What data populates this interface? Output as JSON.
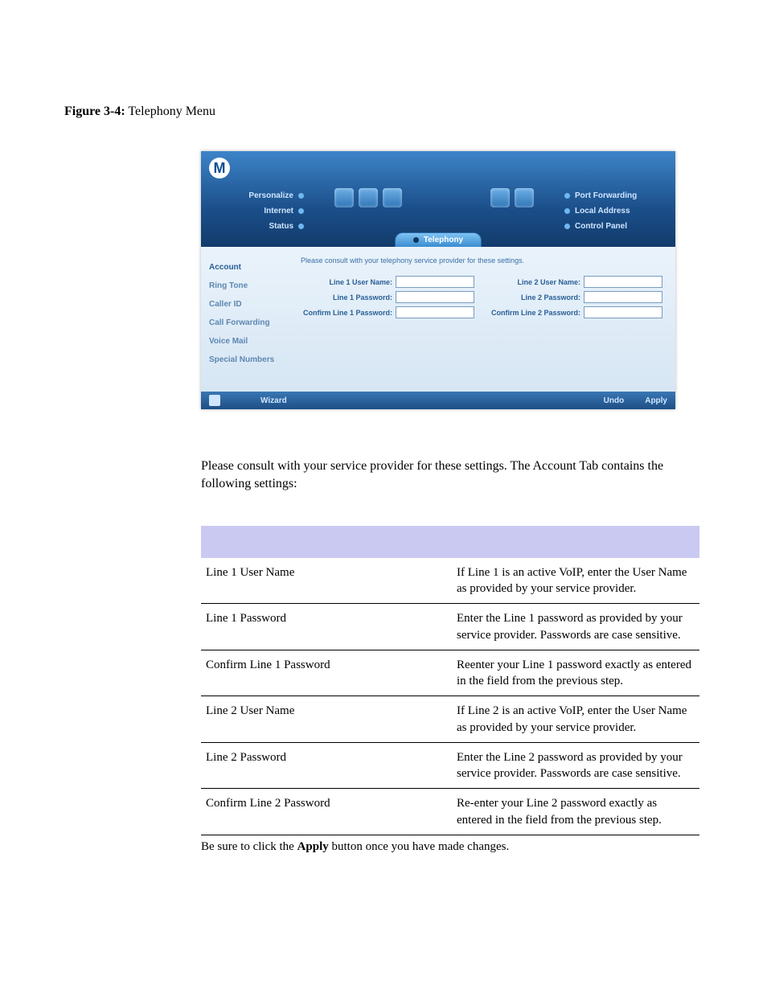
{
  "caption_label": "Figure 3-4:",
  "caption_text": " Telephony Menu",
  "shot": {
    "leftnav": [
      "Personalize",
      "Internet",
      "Status"
    ],
    "rightnav": [
      "Port Forwarding",
      "Local Address",
      "Control Panel"
    ],
    "tab": "Telephony",
    "side": [
      "Account",
      "Ring Tone",
      "Caller ID",
      "Call Forwarding",
      "Voice Mail",
      "Special Numbers"
    ],
    "hint": "Please consult with your telephony service provider for these settings.",
    "col1": [
      "Line 1 User Name:",
      "Line 1 Password:",
      "Confirm Line 1 Password:"
    ],
    "col2": [
      "Line 2 User Name:",
      "Line 2 Password:",
      "Confirm Line 2 Password:"
    ],
    "wizard": "Wizard",
    "undo": "Undo",
    "apply": "Apply"
  },
  "para": "Please consult with your service provider for these settings. The Account Tab contains the following settings:",
  "rows": [
    {
      "k": "Line 1 User Name",
      "v": "If Line 1 is an active VoIP, enter the User Name as provided by your service provider."
    },
    {
      "k": "Line 1 Password",
      "v": "Enter the Line 1 password as provided by your service provider. Passwords are case sensitive."
    },
    {
      "k": "Confirm Line 1 Password",
      "v": "Reenter your Line 1 password exactly as entered in the field from the previous step."
    },
    {
      "k": "Line 2 User Name",
      "v": "If Line 2 is an active VoIP, enter the User Name as provided by your service provider."
    },
    {
      "k": "Line 2 Password",
      "v": "Enter the Line 2 password as provided by your service provider. Passwords are case sensitive."
    },
    {
      "k": "Confirm Line 2 Password",
      "v": "Re-enter your Line 2 password exactly as entered in the field from the previous step."
    }
  ],
  "after_pre": "Be sure to click the ",
  "after_bold": "Apply",
  "after_post": " button once you have made changes."
}
